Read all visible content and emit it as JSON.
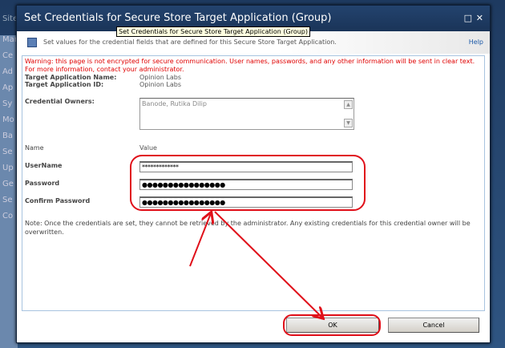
{
  "background": {
    "site_label": "Site",
    "side_fragments": [
      "Man",
      "Ce",
      "Ad",
      "Ap",
      "Sy",
      "Mo",
      "Ba",
      "Se",
      "Up",
      "Ge",
      "Se",
      "Co"
    ]
  },
  "dialog": {
    "title": "Set Credentials for Secure Store Target Application (Group)",
    "toolbar_text": "Set values for the credential fields that are defined for this Secure Store Target Application.",
    "tooltip": "Set Credentials for Secure Store Target Application (Group)",
    "help_label": "Help",
    "warning": "Warning: this page is not encrypted for secure communication. User names, passwords, and any other information will be sent in clear text. For more information, contact your administrator.",
    "target_app_name_label": "Target Application Name:",
    "target_app_name": "Opinion Labs",
    "target_app_id_label": "Target Application ID:",
    "target_app_id": "Opinion Labs",
    "credential_owners_label": "Credential Owners:",
    "credential_owners": "Banode, Rutika Dilip",
    "col_name": "Name",
    "col_value": "Value",
    "fields": [
      {
        "label": "UserName",
        "value": "*************"
      },
      {
        "label": "Password",
        "value": "●●●●●●●●●●●●●●●●"
      },
      {
        "label": "Confirm Password",
        "value": "●●●●●●●●●●●●●●●●"
      }
    ],
    "note": "Note: Once the credentials are set, they cannot be retrieved by the administrator. Any existing credentials for this credential owner will be overwritten.",
    "ok_label": "OK",
    "cancel_label": "Cancel"
  },
  "annotation_color": "#e0101a"
}
